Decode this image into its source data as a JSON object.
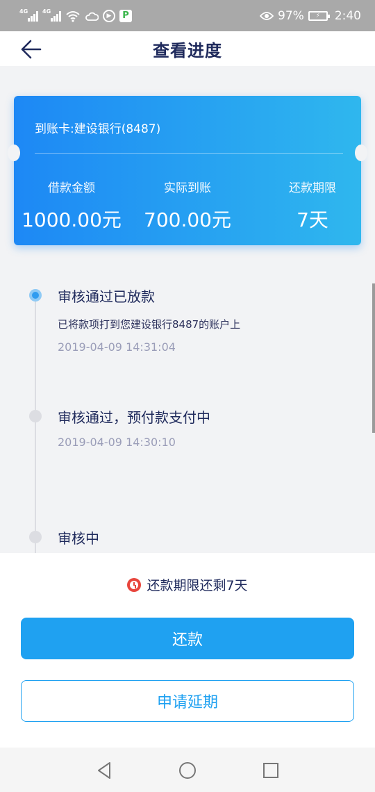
{
  "status_bar": {
    "signal1_tag": "4G",
    "signal2_tag": "4G",
    "battery_percent": "97%",
    "time": "2:40",
    "icons": [
      "signal-icon",
      "signal-icon",
      "wifi-icon",
      "weather-icon",
      "play-icon",
      "p-app-icon",
      "eye-icon",
      "battery-icon"
    ]
  },
  "header": {
    "title": "查看进度",
    "back_icon": "arrow-left-icon"
  },
  "card": {
    "account": "到账卡:建设银行(8487)",
    "stats": [
      {
        "label": "借款金额",
        "value": "1000.00元"
      },
      {
        "label": "实际到账",
        "value": "700.00元"
      },
      {
        "label": "还款期限",
        "value": "7天"
      }
    ],
    "gradient": [
      "#1d88f5",
      "#2fb7ee"
    ]
  },
  "timeline": [
    {
      "title": "审核通过已放款",
      "desc": "已将款项打到您建设银行8487的账户上",
      "time": "2019-04-09 14:31:04",
      "active": true
    },
    {
      "title": "审核通过，预付款支付中",
      "desc": "",
      "time": "2019-04-09 14:30:10",
      "active": false
    },
    {
      "title": "审核中",
      "desc": "",
      "time": "",
      "active": false
    }
  ],
  "bottom": {
    "reminder": "还款期限还剩7天",
    "reminder_icon": "alarm-clock-icon",
    "repay_label": "还款",
    "extend_label": "申请延期",
    "accent": "#1fa1f1"
  },
  "nav": {
    "icons": [
      "back-triangle-icon",
      "home-circle-icon",
      "recents-square-icon"
    ]
  }
}
